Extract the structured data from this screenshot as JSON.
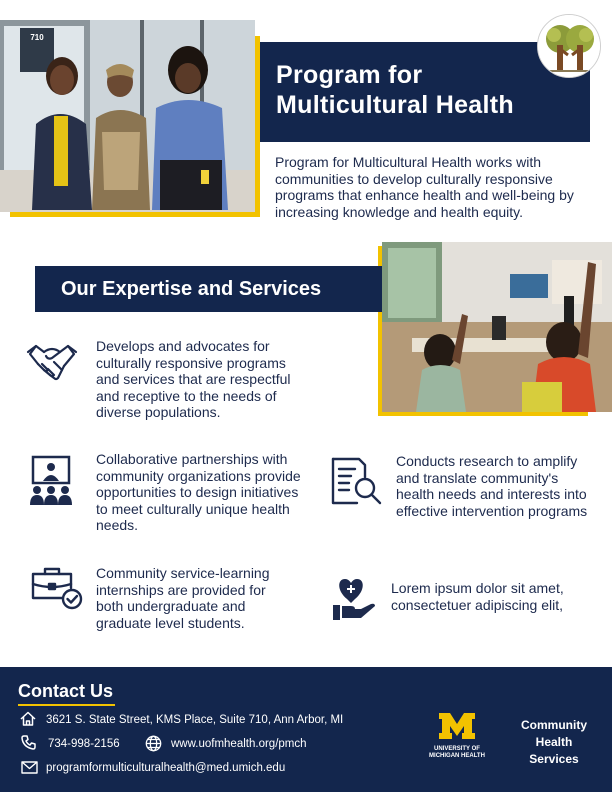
{
  "header": {
    "title_line1": "Program for",
    "title_line2": "Multicultural Health",
    "intro": "Program for Multicultural Health works with communities to develop culturally responsive programs that enhance health and well-being by increasing knowledge and health equity."
  },
  "photo_top": {
    "door_sign_number": "710"
  },
  "expertise": {
    "heading": "Our Expertise and Services",
    "items": [
      {
        "icon": "handshake-icon",
        "text": "Develops and advocates for culturally responsive programs and services that are respectful and receptive to the needs of diverse populations."
      },
      {
        "icon": "presentation-audience-icon",
        "text": "Collaborative partnerships with community organizations provide opportunities to design initiatives to meet culturally unique health needs."
      },
      {
        "icon": "research-document-icon",
        "text": "Conducts research to amplify and translate community's health needs and interests into effective intervention programs"
      },
      {
        "icon": "briefcase-check-icon",
        "text": "Community service-learning internships are provided for both undergraduate and graduate level students."
      },
      {
        "icon": "heart-in-hand-icon",
        "text": "Lorem ipsum dolor sit amet, consectetuer adipiscing elit,"
      }
    ]
  },
  "contact": {
    "heading": "Contact Us",
    "address": "3621 S. State Street, KMS Place, Suite 710, Ann Arbor, MI",
    "phone": "734-998-2156",
    "website": "www.uofmhealth.org/pmch",
    "email": "programformulticulturalhealth@med.umich.edu"
  },
  "branding": {
    "um_letter": "M",
    "um_line1": "UNIVERSITY OF",
    "um_line2": "MICHIGAN HEALTH",
    "chs_line1": "Community",
    "chs_line2": "Health",
    "chs_line3": "Services"
  },
  "colors": {
    "navy": "#13264d",
    "maize": "#f2c200",
    "text": "#1d2a4d"
  }
}
